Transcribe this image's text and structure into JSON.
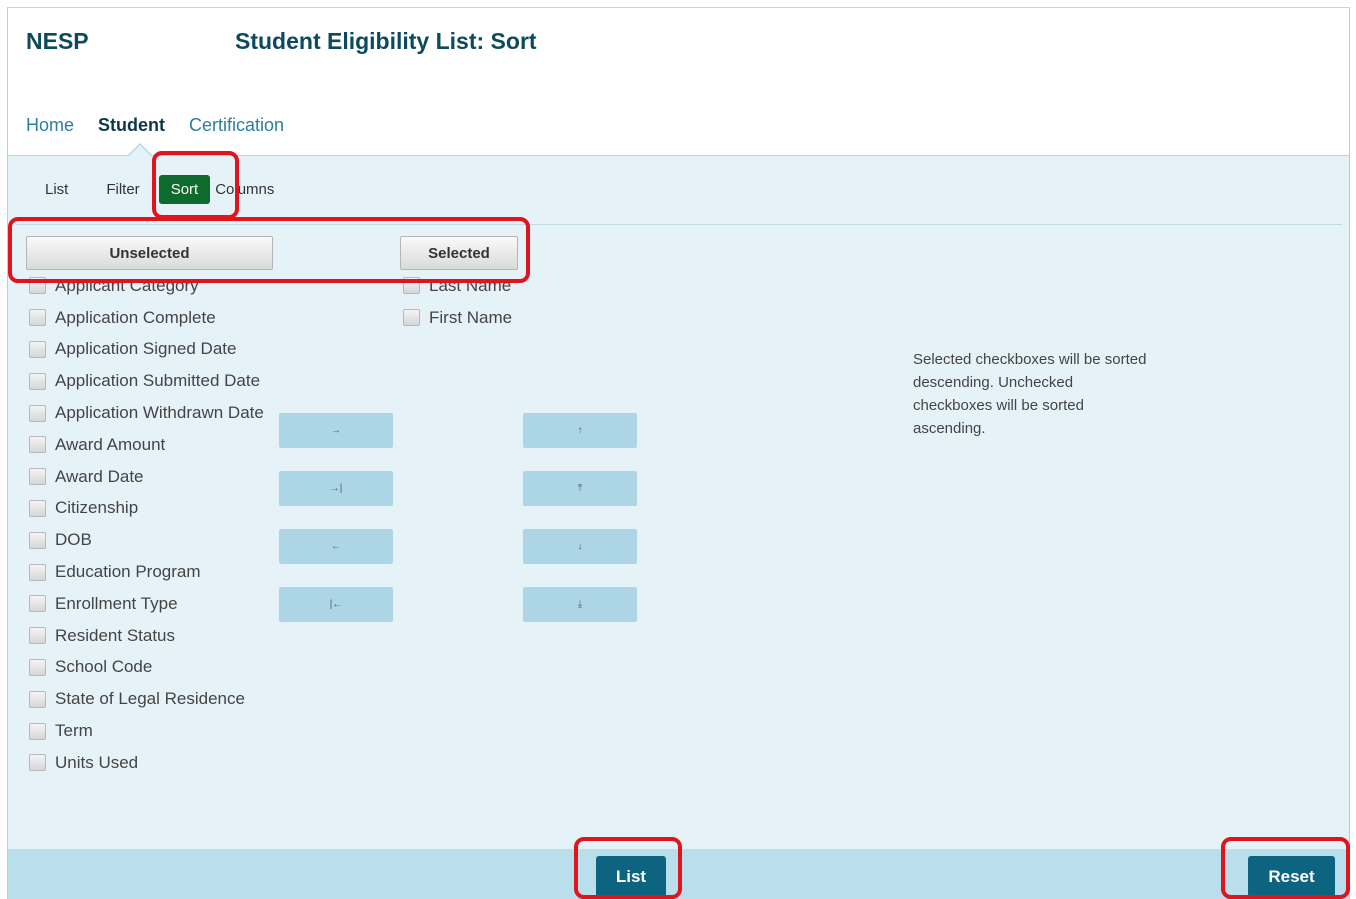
{
  "header": {
    "app_name": "NESP",
    "page_title": "Student Eligibility List: Sort"
  },
  "topnav": {
    "items": [
      {
        "label": "Home",
        "active": false
      },
      {
        "label": "Student",
        "active": true
      },
      {
        "label": "Certification",
        "active": false
      }
    ]
  },
  "subnav": {
    "items": [
      {
        "label": "List",
        "active": false
      },
      {
        "label": "Filter",
        "active": false
      },
      {
        "label": "Sort",
        "active": true
      },
      {
        "label": "Columns",
        "active": false
      }
    ]
  },
  "columns": {
    "unselected_label": "Unselected",
    "selected_label": "Selected"
  },
  "unselected_fields": [
    "Applicant Category",
    "Application Complete",
    "Application Signed Date",
    "Application Submitted Date",
    "Application Withdrawn Date",
    "Award Amount",
    "Award Date",
    "Citizenship",
    "DOB",
    "Education Program",
    "Enrollment Type",
    "Resident Status",
    "School Code",
    "State of Legal Residence",
    "Term",
    "Units Used"
  ],
  "selected_fields": [
    "Last Name",
    "First Name"
  ],
  "move_buttons": {
    "move_right": "→",
    "move_all_right": "→|",
    "move_left": "←",
    "move_all_left": "|←",
    "move_up": "↑",
    "move_top": "⤒",
    "move_down": "↓",
    "move_bottom": "⤓"
  },
  "help_text": "Selected checkboxes will be sorted descending. Unchecked checkboxes will be sorted ascending.",
  "footer": {
    "list_label": "List",
    "reset_label": "Reset"
  },
  "colors": {
    "brand_dark": "#0d4a5e",
    "active_sort_tab": "#0f6a2e",
    "action_button": "#0d6480",
    "highlight": "#e0141c",
    "panel_bg": "#e5f3f9"
  }
}
